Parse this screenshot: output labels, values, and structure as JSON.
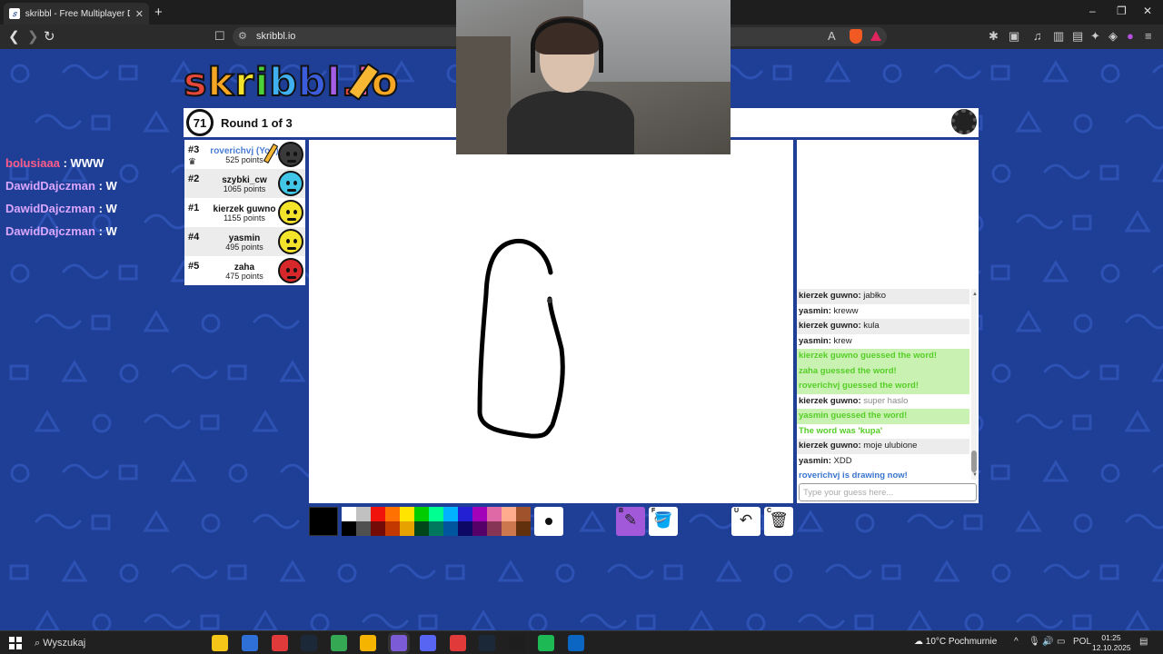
{
  "browser": {
    "tab_title": "skribbl - Free Multiplayer Drawin",
    "tab_favicon": "𝑠",
    "new_tab": "+",
    "url": "skribbl.io",
    "window_controls": {
      "minimize": "–",
      "restore": "❐",
      "close": "✕"
    },
    "nav": {
      "back": "❮",
      "forward": "❯",
      "reload": "↻",
      "bookmark": "🔖"
    }
  },
  "logo": {
    "letters": [
      "s",
      "k",
      "r",
      "i",
      "b",
      "b",
      "l",
      ".",
      "i",
      "o"
    ],
    "colors": [
      "#e5483a",
      "#f5a623",
      "#f3e32b",
      "#4cd137",
      "#41b0f1",
      "#3c5ddb",
      "#a55de6",
      "#e5483a",
      "#ee5fa7",
      "#f5a623"
    ]
  },
  "header": {
    "timer": "71",
    "round_text": "Round 1 of 3"
  },
  "players": [
    {
      "rank": "#3",
      "name": "roverichvj (You)",
      "points": "525 points",
      "is_me": true,
      "drawing": true,
      "crown": true,
      "avatar_color": "#3a3a3a"
    },
    {
      "rank": "#2",
      "name": "szybki_cw",
      "points": "1065 points",
      "is_me": false,
      "drawing": false,
      "crown": false,
      "avatar_color": "#41c6e8"
    },
    {
      "rank": "#1",
      "name": "kierzek guwno",
      "points": "1155 points",
      "is_me": false,
      "drawing": false,
      "crown": false,
      "avatar_color": "#f3e32b"
    },
    {
      "rank": "#4",
      "name": "yasmin",
      "points": "495 points",
      "is_me": false,
      "drawing": false,
      "crown": false,
      "avatar_color": "#f3e32b"
    },
    {
      "rank": "#5",
      "name": "zaha",
      "points": "475 points",
      "is_me": false,
      "drawing": false,
      "crown": false,
      "avatar_color": "#d6282b"
    }
  ],
  "stream_chat": [
    {
      "user": "bolusiaaa",
      "sep": " : ",
      "text": "WWW",
      "color": "#ff5c8a"
    },
    {
      "user": "DawidDajczman",
      "sep": " : ",
      "text": "W",
      "color": "#d9a6ff"
    },
    {
      "user": "DawidDajczman",
      "sep": " : ",
      "text": "W",
      "color": "#d9a6ff"
    },
    {
      "user": "DawidDajczman",
      "sep": " : ",
      "text": "W",
      "color": "#d9a6ff"
    }
  ],
  "chat": {
    "messages": [
      {
        "who": "kierzek guwno:",
        "text": " jabłko",
        "style": "alt"
      },
      {
        "who": "yasmin:",
        "text": " kreww",
        "style": "normal"
      },
      {
        "who": "kierzek guwno:",
        "text": " kula",
        "style": "alt"
      },
      {
        "who": "yasmin:",
        "text": " krew",
        "style": "normal"
      },
      {
        "who": "",
        "text": "kierzek guwno guessed the word!",
        "style": "green"
      },
      {
        "who": "",
        "text": "zaha guessed the word!",
        "style": "green"
      },
      {
        "who": "",
        "text": "roverichvj guessed the word!",
        "style": "green"
      },
      {
        "who": "kierzek guwno:",
        "text": " super haslo",
        "style": "hint"
      },
      {
        "who": "",
        "text": "yasmin guessed the word!",
        "style": "green"
      },
      {
        "who": "",
        "text": "The word was 'kupa'",
        "style": "green-plain"
      },
      {
        "who": "kierzek guwno:",
        "text": " moje ulubione",
        "style": "alt"
      },
      {
        "who": "yasmin:",
        "text": " XDD",
        "style": "normal"
      },
      {
        "who": "",
        "text": "roverichvj is drawing now!",
        "style": "blue"
      }
    ],
    "input_placeholder": "Type your guess here..."
  },
  "toolbar": {
    "current_color": "#000000",
    "palette_top": [
      "#ffffff",
      "#c1c1c1",
      "#ef130b",
      "#ff7100",
      "#ffe400",
      "#00cc00",
      "#00ff91",
      "#00b2ff",
      "#231fd3",
      "#a300ba",
      "#df69a7",
      "#ffac8e",
      "#a0522d"
    ],
    "palette_bottom": [
      "#000000",
      "#505050",
      "#740b07",
      "#c23800",
      "#e8a200",
      "#004619",
      "#00785d",
      "#00569e",
      "#0e0865",
      "#550069",
      "#873554",
      "#cc774d",
      "#63300d"
    ],
    "tools": [
      {
        "key": "B",
        "glyph": "✎",
        "name": "brush"
      },
      {
        "key": "F",
        "glyph": "🪣",
        "name": "fill"
      },
      {
        "key": "U",
        "glyph": "↶",
        "name": "undo"
      },
      {
        "key": "C",
        "glyph": "🗑",
        "name": "clear"
      }
    ]
  },
  "taskbar": {
    "search_placeholder": "Wyszukaj",
    "weather": "10°C  Pochmurnie",
    "language": "POL",
    "time": "01:25",
    "date": "12.10.2025",
    "tray_chevron": "^",
    "app_colors": [
      "#f5c518",
      "#2f6fd8",
      "#e03a3a",
      "#1b2838",
      "#34a853",
      "#f4b400",
      "#7b5cd6",
      "#5865f2",
      "#e03a3a",
      "#1b2838",
      "#1e1e1e",
      "#1db954",
      "#0a66c2"
    ]
  }
}
